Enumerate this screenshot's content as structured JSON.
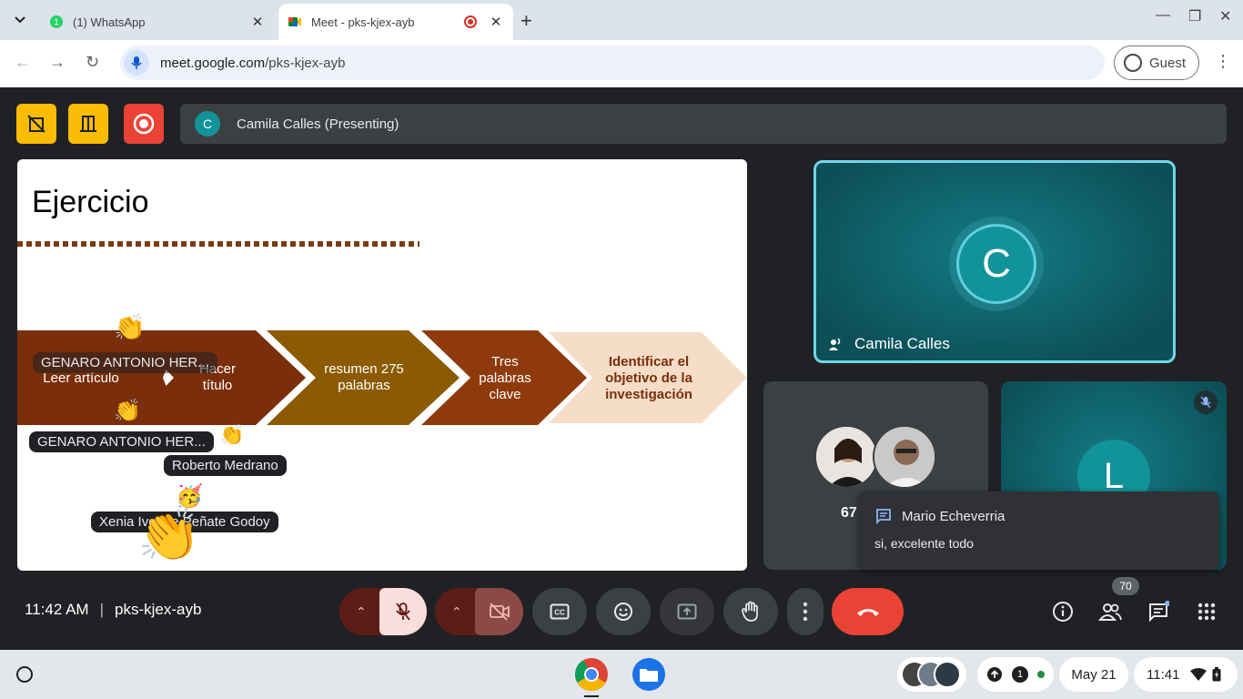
{
  "browser": {
    "tabs": [
      {
        "title": "(1) WhatsApp",
        "active": false
      },
      {
        "title": "Meet - pks-kjex-ayb",
        "active": true
      }
    ],
    "url_host": "meet.google.com",
    "url_path": "/pks-kjex-ayb",
    "profile_label": "Guest"
  },
  "meet": {
    "presenting_initial": "C",
    "presenting_label": "Camila Calles (Presenting)",
    "time": "11:42 AM",
    "code": "pks-kjex-ayb",
    "participant_count": "70",
    "accent_color": "#12939a",
    "end_call_color": "#ea4335"
  },
  "slide": {
    "title": "Ejercicio",
    "steps": [
      {
        "label": "Leer artículo"
      },
      {
        "label": "Hacer título"
      },
      {
        "label": "resumen 275 palabras"
      },
      {
        "label": "Tres palabras clave"
      },
      {
        "label": "Identificar el objetivo de la investigación"
      }
    ],
    "reactions": [
      {
        "name": "GENARO ANTONIO HER..."
      },
      {
        "name": "GENARO ANTONIO HER..."
      },
      {
        "name": "Roberto Medrano"
      },
      {
        "name": "Xenia Ivonne Peñate Godoy"
      }
    ]
  },
  "tiles": {
    "main": {
      "initial": "C",
      "name": "Camila Calles"
    },
    "group": {
      "count": "67"
    },
    "side": {
      "initial": "L"
    }
  },
  "chat": {
    "sender": "Mario Echeverria",
    "message": "si, excelente todo"
  },
  "shelf": {
    "date": "May 21",
    "time": "11:41",
    "notification_count": "1"
  }
}
